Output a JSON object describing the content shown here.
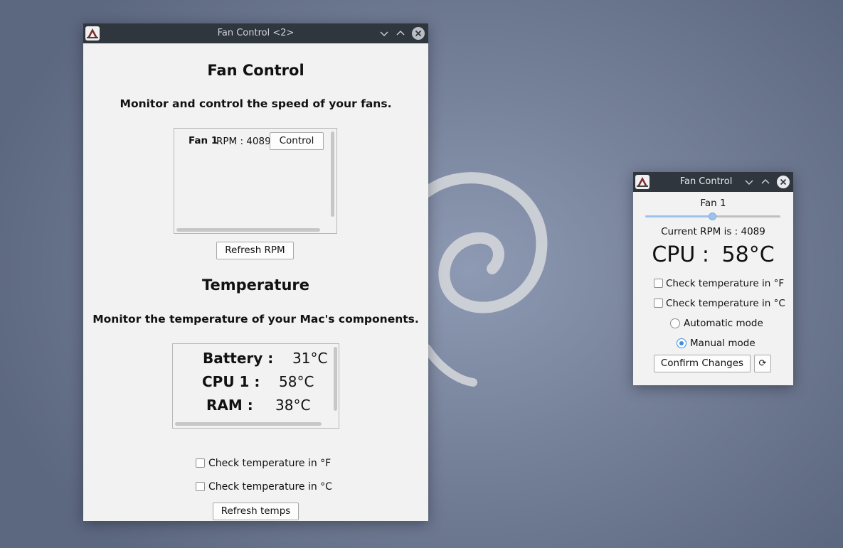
{
  "colors": {
    "window_bg": "#f2f2f2",
    "titlebar_bg": "#30363d",
    "accent": "#3d8ee6",
    "desktop_bg": "#76819a"
  },
  "main_window": {
    "title": "Fan Control <2>",
    "heading": "Fan Control",
    "subheading": "Monitor and control the speed of your fans.",
    "fans": [
      {
        "name": "Fan 1",
        "rpm_text": "RPM : 4089",
        "control_label": "Control"
      }
    ],
    "refresh_rpm_label": "Refresh RPM",
    "temp_heading": "Temperature",
    "temp_subheading": "Monitor the temperature of your Mac's components.",
    "temps": [
      {
        "label": "Battery :",
        "value": "31°C"
      },
      {
        "label": "CPU 1 :",
        "value": "58°C"
      },
      {
        "label": "RAM :",
        "value": "38°C"
      }
    ],
    "check_f_label": "Check temperature in °F",
    "check_c_label": "Check temperature in °C",
    "refresh_temps_label": "Refresh temps"
  },
  "fan_window": {
    "title": "Fan Control",
    "fan_name": "Fan 1",
    "slider_fraction": 0.5,
    "current_rpm": "Current RPM is : 4089",
    "cpu_label": "CPU :",
    "cpu_value": "58°C",
    "check_f_label": "Check temperature in °F",
    "check_c_label": "Check temperature in °C",
    "auto_mode_label": "Automatic mode",
    "manual_mode_label": "Manual mode",
    "selected_mode": "manual",
    "confirm_label": "Confirm Changes",
    "refresh_icon": "refresh-icon",
    "refresh_glyph": "⟳"
  }
}
